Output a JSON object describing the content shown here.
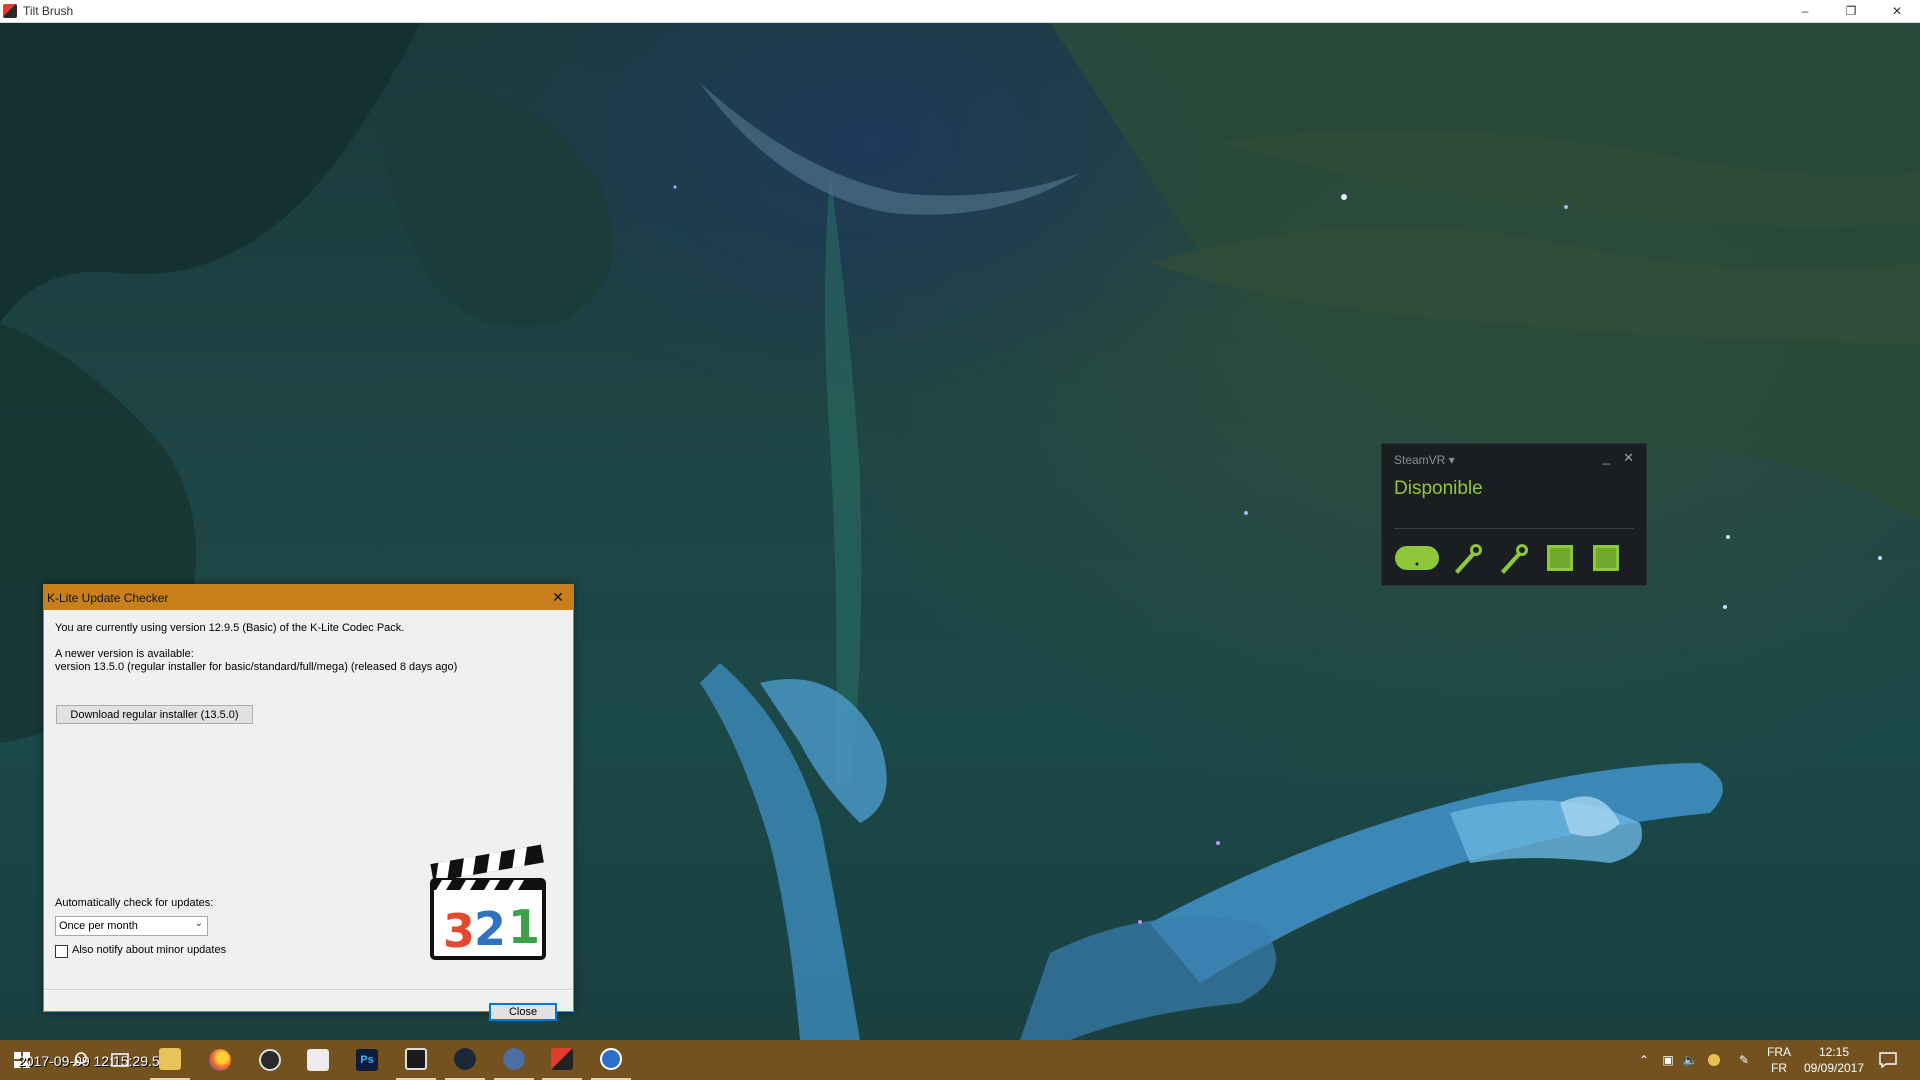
{
  "app": {
    "title": "Tilt Brush",
    "controls": [
      "minimize-icon",
      "restore-icon",
      "close-icon"
    ]
  },
  "steamvr": {
    "menu_label": "SteamVR ▾",
    "status": "Disponible",
    "devices": [
      "headset-icon",
      "controller-icon",
      "controller-icon",
      "base-station-icon",
      "base-station-icon"
    ],
    "accent_color": "#8fc73a"
  },
  "dialog": {
    "title": "K-Lite Update Checker",
    "current_version_text": "You are currently using version 12.9.5 (Basic) of the K-Lite Codec Pack.",
    "newer_available_text": "A newer version is available:",
    "newer_version_text": "version 13.5.0  (regular installer for basic/standard/full/mega)  (released 8 days ago)",
    "download_button": "Download regular installer (13.5.0)",
    "auto_check_label": "Automatically check for updates:",
    "auto_check_value": "Once per month",
    "minor_updates_label": "Also notify about minor updates",
    "minor_updates_checked": false,
    "close_button": "Close",
    "logo_digits": "321",
    "accent_color": "#c8801d"
  },
  "taskbar": {
    "overlay_text": "2017-09-09 12:15:29.50",
    "apps": [
      "firefox-icon",
      "steam-client-icon",
      "sculpt-app-icon",
      "photoshop-icon",
      "media-icon",
      "steam-icon",
      "vr-app-icon",
      "tilt-brush-icon",
      "compass-app-icon"
    ],
    "language_top": "FRA",
    "language_bottom": "FR",
    "time": "12:15",
    "date": "09/09/2017",
    "color": "#73521f"
  }
}
